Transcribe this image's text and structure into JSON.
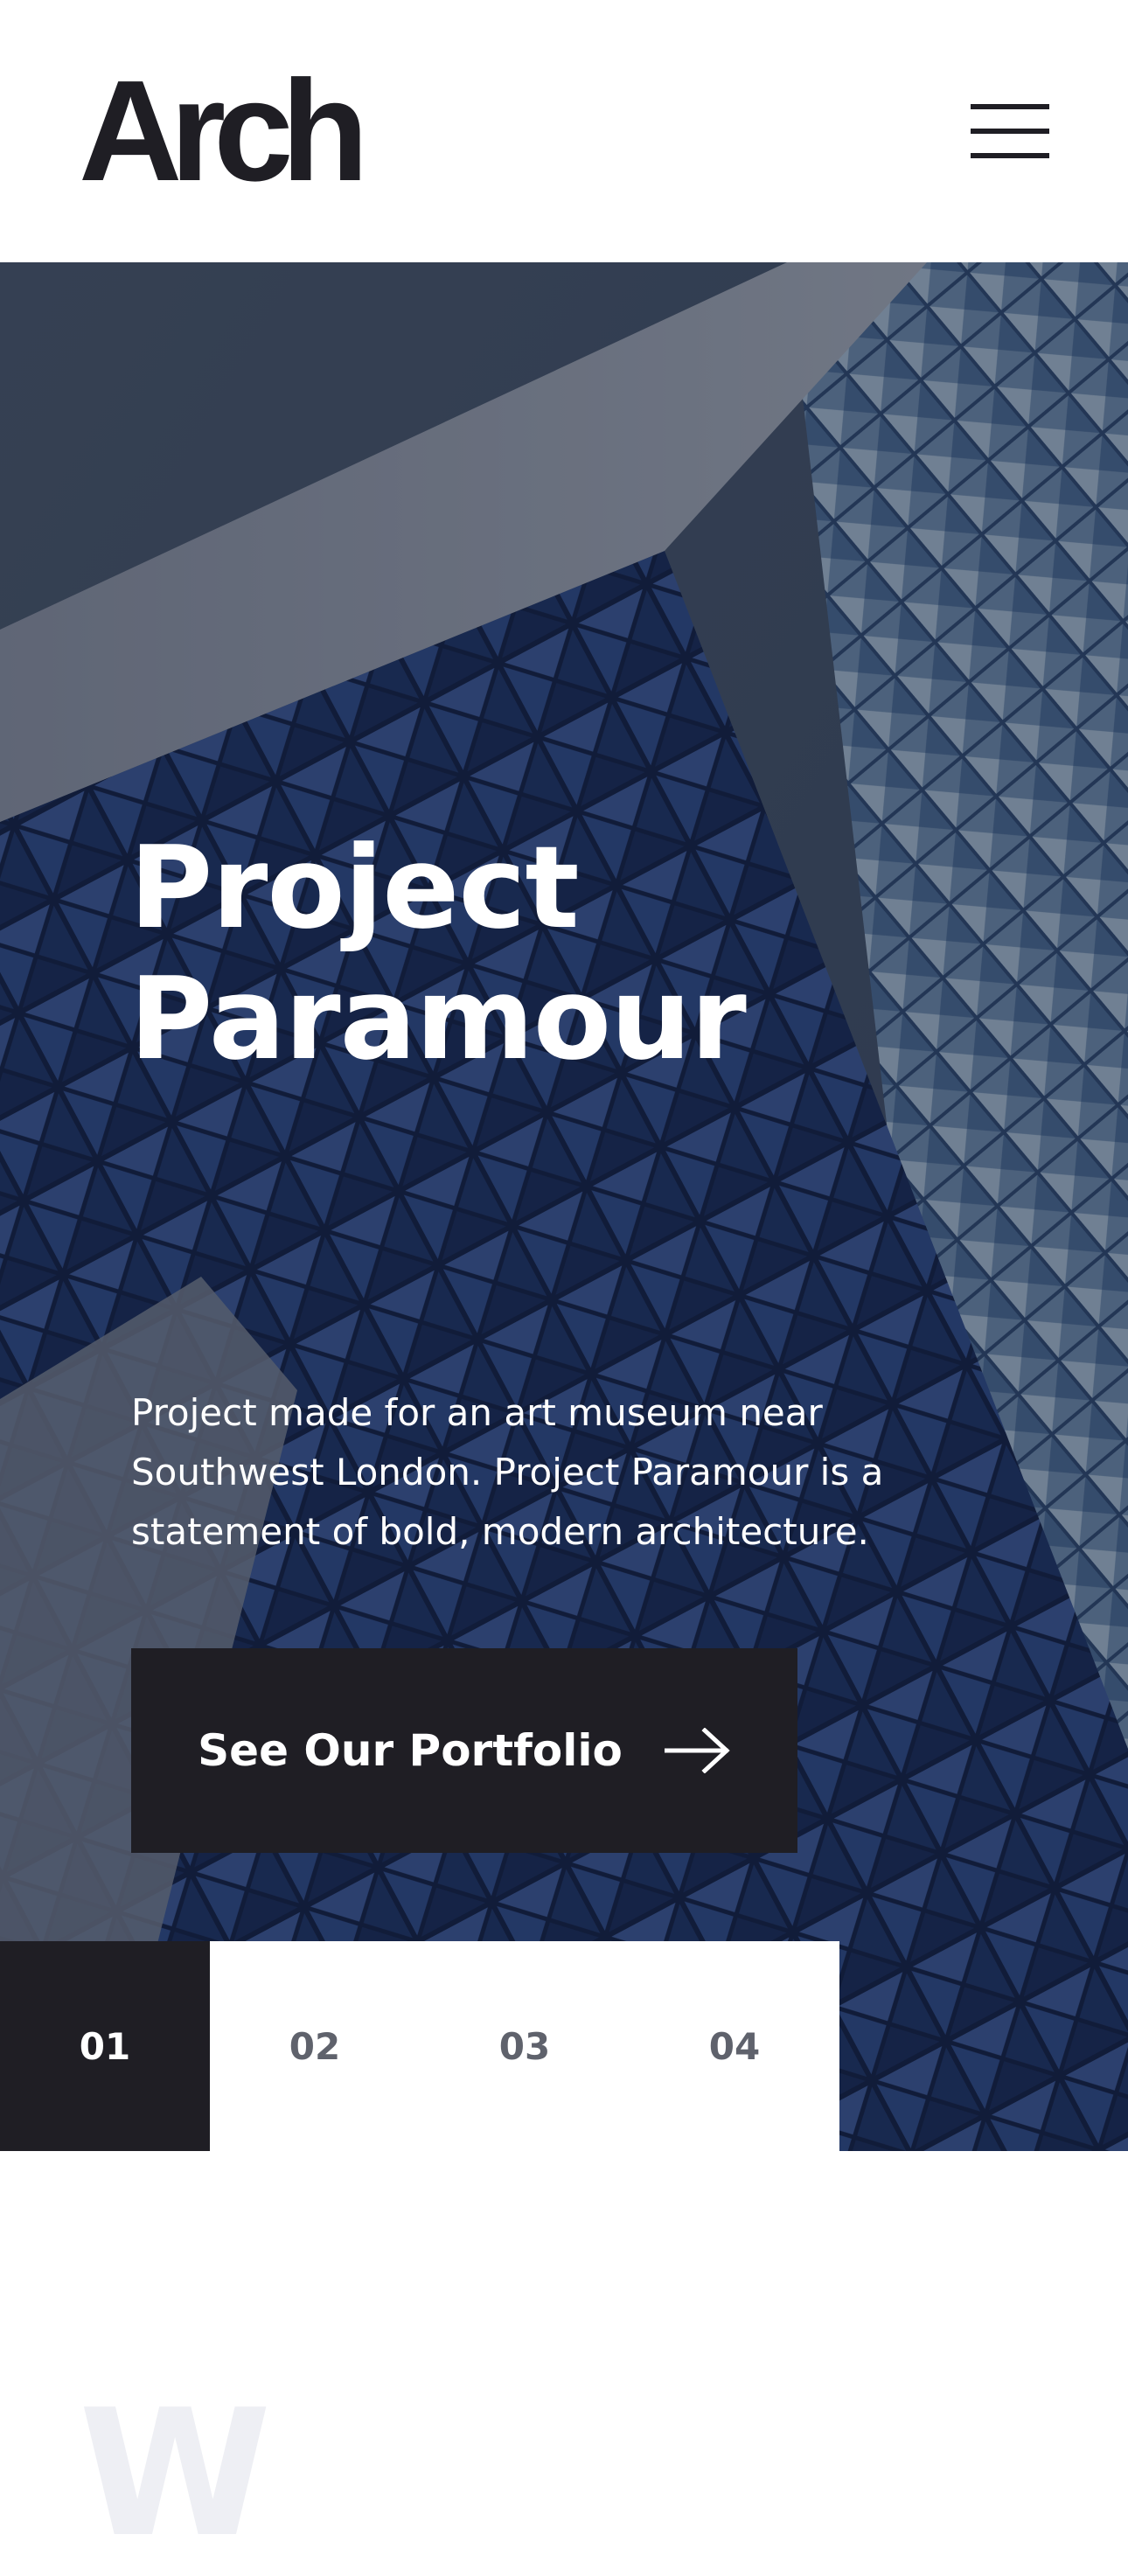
{
  "header": {
    "logo_text": "Arch",
    "menu_icon": "hamburger-icon"
  },
  "hero": {
    "title_line1": "Project",
    "title_line2": "Paramour",
    "description": "Project made for an art museum near Southwest London. Project Paramour is a statement of bold, modern architecture.",
    "cta_label": "See Our Portfolio",
    "cta_icon": "arrow-right-icon",
    "background_image": "building-facade-image"
  },
  "pagination": {
    "items": [
      "01",
      "02",
      "03",
      "04"
    ],
    "active_index": 0
  },
  "next_section": {
    "heading_peek": "W"
  },
  "colors": {
    "dark": "#1f1e24",
    "white": "#ffffff",
    "muted_text": "#5f626c",
    "faint_heading": "#eeeff4"
  }
}
